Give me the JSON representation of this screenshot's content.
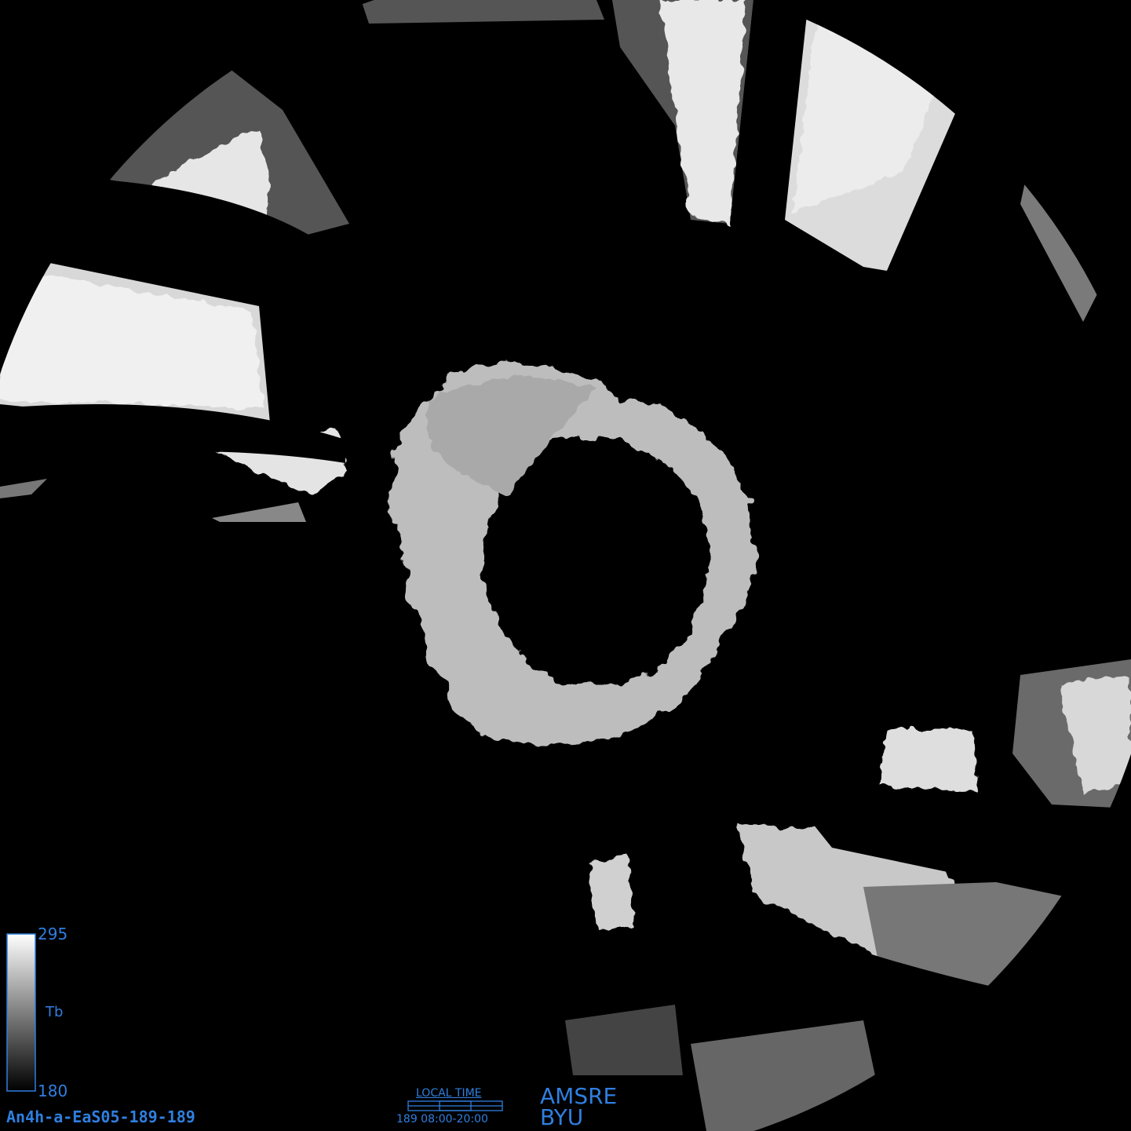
{
  "colorbar": {
    "max_label": "295",
    "min_label": "180",
    "variable_label": "Tb",
    "min_color": "#000000",
    "max_color": "#ffffff"
  },
  "image_id": "An4h-a-EaS05-189-189",
  "local_time": {
    "title": "LOCAL TIME",
    "range": "189 08:00-20:00"
  },
  "source": {
    "sensor": "AMSRE",
    "institution": "BYU"
  },
  "colors": {
    "label_text": "#2f7fe0",
    "background": "#000000"
  }
}
